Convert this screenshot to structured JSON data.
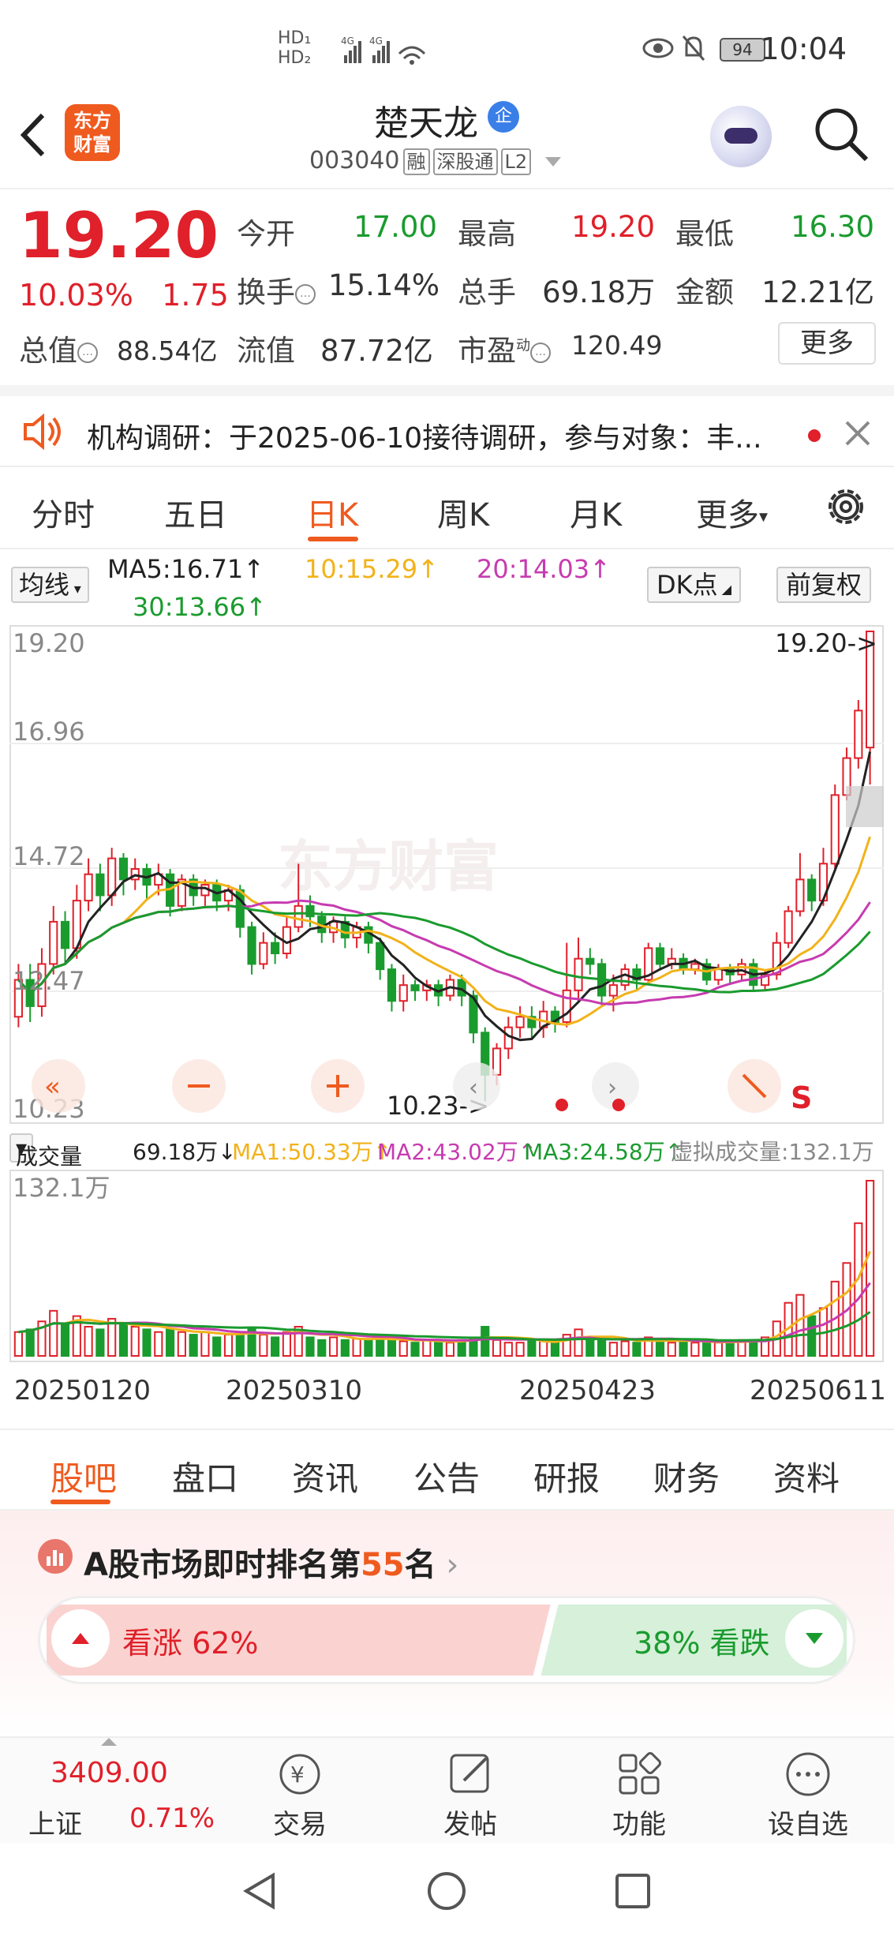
{
  "status_bar": {
    "network": "4G",
    "battery": "94",
    "time": "10:04"
  },
  "header": {
    "brand_logo": "东方财富",
    "stock_name": "楚天龙",
    "corp_badge": "企",
    "stock_code": "003040",
    "tags": [
      "融",
      "深股通",
      "L2"
    ]
  },
  "quote": {
    "price": "19.20",
    "change_pct": "10.03%",
    "change": "1.75",
    "fields": [
      {
        "label": "今开",
        "value": "17.00"
      },
      {
        "label": "最高",
        "value": "19.20"
      },
      {
        "label": "最低",
        "value": "16.30"
      },
      {
        "label": "换手",
        "value": "15.14%"
      },
      {
        "label": "总手",
        "value": "69.18万"
      },
      {
        "label": "金额",
        "value": "12.21亿"
      },
      {
        "label": "总值",
        "value": "88.54亿"
      },
      {
        "label": "流值",
        "value": "87.72亿"
      },
      {
        "label": "市盈",
        "superscript": "动",
        "value": "120.49"
      }
    ],
    "more_label": "更多"
  },
  "notice": {
    "text": "机构调研：于2025-06-10接待调研，参与对象：丰..."
  },
  "chart_tabs": [
    "分时",
    "五日",
    "日K",
    "周K",
    "月K",
    "更多"
  ],
  "active_chart_tab": "日K",
  "kline_header": {
    "indicator_select": "均线",
    "ma5": "MA5:16.71↑",
    "ma10": "10:15.29↑",
    "ma20": "20:14.03↑",
    "ma30": "30:13.66↑",
    "dk_label": "DK点",
    "adjust_label": "前复权"
  },
  "colors": {
    "up": "#e0202a",
    "down": "#1a9b2e",
    "ma5": "#222222",
    "ma10": "#f2b21a",
    "ma20": "#c73bb0",
    "ma30": "#1a9b2e",
    "accent": "#ef5a1f"
  },
  "chart_data": {
    "type": "candlestick",
    "y_ticks": [
      "19.20",
      "16.96",
      "14.72",
      "12.47",
      "10.23"
    ],
    "ylim": [
      10.23,
      19.2
    ],
    "max_label": "19.20->",
    "min_label": "10.23->",
    "x_labels": [
      "20250120",
      "20250310",
      "20250423",
      "20250611"
    ],
    "candles": [
      [
        11.9,
        12.6,
        11.7,
        12.9
      ],
      [
        12.6,
        12.1,
        11.8,
        12.9
      ],
      [
        12.1,
        12.9,
        11.9,
        13.2
      ],
      [
        12.9,
        13.7,
        12.7,
        14.0
      ],
      [
        13.7,
        13.2,
        12.9,
        13.9
      ],
      [
        13.2,
        14.1,
        13.0,
        14.4
      ],
      [
        14.1,
        14.6,
        13.9,
        14.9
      ],
      [
        14.6,
        14.2,
        13.9,
        14.8
      ],
      [
        14.2,
        14.9,
        14.0,
        15.1
      ],
      [
        14.9,
        14.5,
        14.2,
        15.0
      ],
      [
        14.5,
        14.7,
        14.3,
        14.9
      ],
      [
        14.7,
        14.4,
        14.1,
        14.8
      ],
      [
        14.4,
        14.6,
        14.2,
        14.8
      ],
      [
        14.6,
        14.0,
        13.8,
        14.7
      ],
      [
        14.0,
        14.5,
        13.9,
        14.6
      ],
      [
        14.5,
        14.2,
        14.0,
        14.6
      ],
      [
        14.2,
        14.4,
        14.0,
        14.5
      ],
      [
        14.4,
        14.1,
        13.9,
        14.5
      ],
      [
        14.1,
        14.3,
        13.9,
        14.4
      ],
      [
        14.3,
        13.6,
        13.4,
        14.4
      ],
      [
        13.6,
        12.9,
        12.7,
        13.7
      ],
      [
        12.9,
        13.3,
        12.8,
        13.5
      ],
      [
        13.3,
        13.1,
        12.9,
        13.5
      ],
      [
        13.1,
        13.6,
        13.0,
        13.8
      ],
      [
        13.6,
        14.0,
        13.5,
        14.8
      ],
      [
        14.0,
        13.8,
        13.6,
        14.2
      ],
      [
        13.8,
        13.5,
        13.3,
        13.9
      ],
      [
        13.5,
        13.7,
        13.3,
        13.8
      ],
      [
        13.7,
        13.4,
        13.2,
        13.8
      ],
      [
        13.4,
        13.6,
        13.2,
        13.7
      ],
      [
        13.6,
        13.3,
        13.1,
        13.7
      ],
      [
        13.3,
        12.8,
        12.6,
        13.4
      ],
      [
        12.8,
        12.2,
        12.0,
        12.9
      ],
      [
        12.2,
        12.5,
        12.0,
        12.7
      ],
      [
        12.5,
        12.4,
        12.2,
        12.6
      ],
      [
        12.4,
        12.5,
        12.2,
        12.6
      ],
      [
        12.5,
        12.3,
        12.1,
        12.6
      ],
      [
        12.3,
        12.6,
        12.2,
        12.7
      ],
      [
        12.6,
        12.3,
        12.1,
        12.7
      ],
      [
        12.3,
        11.6,
        11.4,
        12.4
      ],
      [
        11.6,
        10.8,
        10.3,
        11.7
      ],
      [
        10.8,
        11.3,
        10.6,
        11.4
      ],
      [
        11.3,
        11.7,
        11.1,
        11.9
      ],
      [
        11.7,
        11.9,
        11.5,
        12.1
      ],
      [
        11.9,
        11.7,
        11.5,
        12.1
      ],
      [
        11.7,
        12.0,
        11.5,
        12.2
      ],
      [
        12.0,
        11.8,
        11.6,
        12.1
      ],
      [
        11.8,
        12.4,
        11.7,
        13.3
      ],
      [
        12.4,
        13.0,
        12.2,
        13.4
      ],
      [
        13.0,
        12.9,
        12.7,
        13.2
      ],
      [
        12.9,
        12.3,
        12.1,
        13.0
      ],
      [
        12.3,
        12.5,
        12.0,
        12.7
      ],
      [
        12.5,
        12.8,
        12.4,
        12.9
      ],
      [
        12.8,
        12.6,
        12.4,
        12.9
      ],
      [
        12.6,
        13.2,
        12.5,
        13.3
      ],
      [
        13.2,
        12.9,
        12.8,
        13.3
      ],
      [
        12.9,
        13.0,
        12.8,
        13.2
      ],
      [
        13.0,
        12.8,
        12.7,
        13.1
      ],
      [
        12.8,
        12.9,
        12.7,
        13.0
      ],
      [
        12.9,
        12.6,
        12.5,
        13.0
      ],
      [
        12.6,
        12.8,
        12.5,
        12.9
      ],
      [
        12.8,
        12.7,
        12.5,
        12.9
      ],
      [
        12.7,
        12.9,
        12.6,
        13.0
      ],
      [
        12.9,
        12.5,
        12.4,
        13.0
      ],
      [
        12.5,
        12.7,
        12.4,
        12.8
      ],
      [
        12.7,
        13.3,
        12.6,
        13.5
      ],
      [
        13.3,
        13.9,
        13.2,
        14.0
      ],
      [
        13.9,
        14.5,
        13.8,
        15.0
      ],
      [
        14.5,
        14.1,
        13.9,
        14.6
      ],
      [
        14.1,
        14.8,
        14.0,
        15.1
      ],
      [
        14.8,
        16.1,
        14.7,
        16.3
      ],
      [
        16.1,
        16.8,
        16.0,
        17.0
      ],
      [
        16.8,
        17.7,
        16.6,
        17.9
      ],
      [
        17.0,
        19.2,
        16.3,
        19.2
      ]
    ],
    "volume": {
      "ymax_label": "132.1万",
      "values": [
        18,
        20,
        26,
        34,
        24,
        30,
        22,
        20,
        28,
        24,
        22,
        20,
        18,
        20,
        18,
        16,
        18,
        14,
        16,
        18,
        20,
        16,
        14,
        18,
        22,
        14,
        12,
        14,
        12,
        13,
        12,
        14,
        12,
        11,
        10,
        12,
        11,
        10,
        12,
        14,
        22,
        12,
        10,
        10,
        11,
        12,
        10,
        16,
        20,
        14,
        12,
        10,
        11,
        10,
        14,
        12,
        10,
        11,
        10,
        11,
        10,
        10,
        12,
        12,
        14,
        26,
        40,
        46,
        30,
        36,
        56,
        70,
        100,
        132
      ]
    }
  },
  "volume_legend": {
    "select": "成交量",
    "vol": "69.18万↓",
    "ma1": "MA1:50.33万↑",
    "ma2": "MA2:43.02万↑",
    "ma3": "MA3:24.58万↑",
    "virtual": "虚拟成交量:132.1万"
  },
  "bottom_tabs": [
    "股吧",
    "盘口",
    "资讯",
    "公告",
    "研报",
    "财务",
    "资料"
  ],
  "ranking": {
    "prefix": "A股市场即时排名第",
    "rank": "55",
    "suffix": "名"
  },
  "sentiment": {
    "up_label": "看涨 62%",
    "down_label": "38% 看跌",
    "up_pct": 62
  },
  "footer": {
    "index_value": "3409.00",
    "index_name": "上证",
    "index_change": "0.71%",
    "items": [
      "交易",
      "发帖",
      "功能",
      "设自选"
    ]
  }
}
